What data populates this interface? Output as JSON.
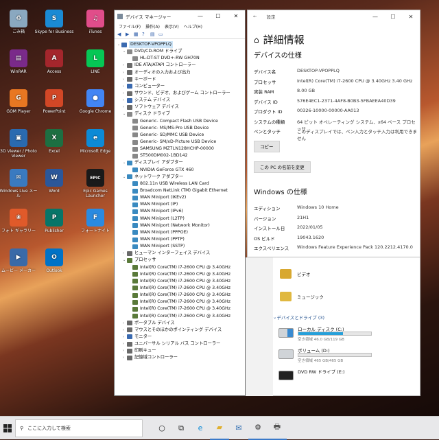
{
  "desktop": {
    "icons": [
      {
        "label": "ごみ箱",
        "icon": "recycle-bin-icon",
        "color": "#8aa8c0",
        "glyph": "♻"
      },
      {
        "label": "Skype for Business",
        "icon": "skype-icon",
        "color": "#1a8ad4",
        "glyph": "S"
      },
      {
        "label": "iTunes",
        "icon": "itunes-icon",
        "color": "#e14d8a",
        "glyph": "♫"
      },
      {
        "label": "WinRAR",
        "icon": "winrar-icon",
        "color": "#7a2a8a",
        "glyph": "▤"
      },
      {
        "label": "Access",
        "icon": "access-icon",
        "color": "#a4262c",
        "glyph": "A"
      },
      {
        "label": "LINE",
        "icon": "line-icon",
        "color": "#06c755",
        "glyph": "L"
      },
      {
        "label": "GOM Player",
        "icon": "gom-player-icon",
        "color": "#e87722",
        "glyph": "G"
      },
      {
        "label": "PowerPoint",
        "icon": "powerpoint-icon",
        "color": "#d24726",
        "glyph": "P"
      },
      {
        "label": "Google Chrome",
        "icon": "chrome-icon",
        "color": "#4285f4",
        "glyph": "●"
      },
      {
        "label": "3D Viewer / Photo Viewer",
        "icon": "photo-viewer-icon",
        "color": "#2a6ab0",
        "glyph": "▣"
      },
      {
        "label": "Excel",
        "icon": "excel-icon",
        "color": "#1d6f42",
        "glyph": "X"
      },
      {
        "label": "Microsoft Edge",
        "icon": "edge-icon",
        "color": "#0c8ad6",
        "glyph": "e"
      },
      {
        "label": "Windows Live メール",
        "icon": "windows-live-mail-icon",
        "color": "#3a7ac0",
        "glyph": "✉"
      },
      {
        "label": "Word",
        "icon": "word-icon",
        "color": "#2b579a",
        "glyph": "W"
      },
      {
        "label": "Epic Games Launcher",
        "icon": "epic-games-icon",
        "color": "#1a1a1a",
        "glyph": "EPIC"
      },
      {
        "label": "フォト ギャラリー",
        "icon": "photo-gallery-icon",
        "color": "#e05a2a",
        "glyph": "❀"
      },
      {
        "label": "Publisher",
        "icon": "publisher-icon",
        "color": "#077568",
        "glyph": "P"
      },
      {
        "label": "フォートナイト",
        "icon": "fortnite-icon",
        "color": "#2a8ae0",
        "glyph": "F"
      },
      {
        "label": "ムービー メーカー",
        "icon": "movie-maker-icon",
        "color": "#3a6aa8",
        "glyph": "▶"
      },
      {
        "label": "Outlook",
        "icon": "outlook-icon",
        "color": "#0072c6",
        "glyph": "O"
      }
    ]
  },
  "devmgr": {
    "title": "デバイス マネージャー",
    "menu": [
      "ファイル(F)",
      "操作(A)",
      "表示(V)",
      "ヘルプ(H)"
    ],
    "tree": [
      {
        "text": "DESKTOP-VPOPPLQ",
        "level": 0,
        "arrow": "v",
        "color": "#3a6ab0"
      },
      {
        "text": "DVD/CD-ROM ドライブ",
        "level": 1,
        "arrow": "v",
        "color": "#888888"
      },
      {
        "text": "HL-DT-ST DVD+-RW GH70N",
        "level": 2,
        "arrow": "",
        "color": "#888888"
      },
      {
        "text": "IDE ATA/ATAPI コントローラー",
        "level": 1,
        "arrow": ">",
        "color": "#6a6a6a"
      },
      {
        "text": "オーディオの入力および出力",
        "level": 1,
        "arrow": ">",
        "color": "#6a6a6a"
      },
      {
        "text": "キーボード",
        "level": 1,
        "arrow": ">",
        "color": "#6a6a6a"
      },
      {
        "text": "コンピューター",
        "level": 1,
        "arrow": ">",
        "color": "#3a6ab0"
      },
      {
        "text": "サウンド、ビデオ、およびゲーム コントローラー",
        "level": 1,
        "arrow": ">",
        "color": "#6a6a6a"
      },
      {
        "text": "システム デバイス",
        "level": 1,
        "arrow": ">",
        "color": "#3a6ab0"
      },
      {
        "text": "ソフトウェア デバイス",
        "level": 1,
        "arrow": ">",
        "color": "#6a6a6a"
      },
      {
        "text": "ディスク ドライブ",
        "level": 1,
        "arrow": "v",
        "color": "#888888"
      },
      {
        "text": "Generic- Compact Flash USB Device",
        "level": 2,
        "arrow": "",
        "color": "#888888"
      },
      {
        "text": "Generic- MS/MS-Pro USB Device",
        "level": 2,
        "arrow": "",
        "color": "#888888"
      },
      {
        "text": "Generic- SD/MMC USB Device",
        "level": 2,
        "arrow": "",
        "color": "#888888"
      },
      {
        "text": "Generic- SM/xD-Picture USB Device",
        "level": 2,
        "arrow": "",
        "color": "#888888"
      },
      {
        "text": "SAMSUNG MZ7LN128HCHP-00000",
        "level": 2,
        "arrow": "",
        "color": "#888888"
      },
      {
        "text": "ST500DM002-1BD142",
        "level": 2,
        "arrow": "",
        "color": "#888888"
      },
      {
        "text": "ディスプレイ アダプター",
        "level": 1,
        "arrow": "v",
        "color": "#3a8ac0"
      },
      {
        "text": "NVIDIA GeForce GTX 460",
        "level": 2,
        "arrow": "",
        "color": "#3a8ac0"
      },
      {
        "text": "ネットワーク アダプター",
        "level": 1,
        "arrow": "v",
        "color": "#3a8ac0"
      },
      {
        "text": "802.11n USB Wireless LAN Card",
        "level": 2,
        "arrow": "",
        "color": "#3a8ac0"
      },
      {
        "text": "Broadcom NetLink (TM) Gigabit Ethernet",
        "level": 2,
        "arrow": "",
        "color": "#3a8ac0"
      },
      {
        "text": "WAN Miniport (IKEv2)",
        "level": 2,
        "arrow": "",
        "color": "#3a8ac0"
      },
      {
        "text": "WAN Miniport (IP)",
        "level": 2,
        "arrow": "",
        "color": "#3a8ac0"
      },
      {
        "text": "WAN Miniport (IPv6)",
        "level": 2,
        "arrow": "",
        "color": "#3a8ac0"
      },
      {
        "text": "WAN Miniport (L2TP)",
        "level": 2,
        "arrow": "",
        "color": "#3a8ac0"
      },
      {
        "text": "WAN Miniport (Network Monitor)",
        "level": 2,
        "arrow": "",
        "color": "#3a8ac0"
      },
      {
        "text": "WAN Miniport (PPPOE)",
        "level": 2,
        "arrow": "",
        "color": "#3a8ac0"
      },
      {
        "text": "WAN Miniport (PPTP)",
        "level": 2,
        "arrow": "",
        "color": "#3a8ac0"
      },
      {
        "text": "WAN Miniport (SSTP)",
        "level": 2,
        "arrow": "",
        "color": "#3a8ac0"
      },
      {
        "text": "ヒューマン インターフェイス デバイス",
        "level": 1,
        "arrow": ">",
        "color": "#6a6a6a"
      },
      {
        "text": "プロセッサ",
        "level": 1,
        "arrow": "v",
        "color": "#5a7a3a"
      },
      {
        "text": "Intel(R) Core(TM) i7-2600 CPU @ 3.40GHz",
        "level": 2,
        "arrow": "",
        "color": "#5a7a3a"
      },
      {
        "text": "Intel(R) Core(TM) i7-2600 CPU @ 3.40GHz",
        "level": 2,
        "arrow": "",
        "color": "#5a7a3a"
      },
      {
        "text": "Intel(R) Core(TM) i7-2600 CPU @ 3.40GHz",
        "level": 2,
        "arrow": "",
        "color": "#5a7a3a"
      },
      {
        "text": "Intel(R) Core(TM) i7-2600 CPU @ 3.40GHz",
        "level": 2,
        "arrow": "",
        "color": "#5a7a3a"
      },
      {
        "text": "Intel(R) Core(TM) i7-2600 CPU @ 3.40GHz",
        "level": 2,
        "arrow": "",
        "color": "#5a7a3a"
      },
      {
        "text": "Intel(R) Core(TM) i7-2600 CPU @ 3.40GHz",
        "level": 2,
        "arrow": "",
        "color": "#5a7a3a"
      },
      {
        "text": "Intel(R) Core(TM) i7-2600 CPU @ 3.40GHz",
        "level": 2,
        "arrow": "",
        "color": "#5a7a3a"
      },
      {
        "text": "Intel(R) Core(TM) i7-2600 CPU @ 3.40GHz",
        "level": 2,
        "arrow": "",
        "color": "#5a7a3a"
      },
      {
        "text": "ポータブル デバイス",
        "level": 1,
        "arrow": ">",
        "color": "#6a6a6a"
      },
      {
        "text": "マウスとそのほかのポインティング デバイス",
        "level": 1,
        "arrow": ">",
        "color": "#6a6a6a"
      },
      {
        "text": "モニター",
        "level": 1,
        "arrow": ">",
        "color": "#3a6ab0"
      },
      {
        "text": "ユニバーサル シリアル バス コントローラー",
        "level": 1,
        "arrow": ">",
        "color": "#6a6a6a"
      },
      {
        "text": "印刷キュー",
        "level": 1,
        "arrow": ">",
        "color": "#6a6a6a"
      },
      {
        "text": "記憶域コントローラー",
        "level": 1,
        "arrow": ">",
        "color": "#6a6a6a"
      }
    ]
  },
  "settings": {
    "title": "設定",
    "page_title": "詳細情報",
    "device_heading": "デバイスの仕様",
    "device_specs": [
      {
        "k": "デバイス名",
        "v": "DESKTOP-VPOPPLQ"
      },
      {
        "k": "プロセッサ",
        "v": "Intel(R) Core(TM) i7-2600 CPU @ 3.40GHz   3.40 GHz"
      },
      {
        "k": "実装 RAM",
        "v": "8.00 GB"
      },
      {
        "k": "デバイス ID",
        "v": "576E4EC1-2371-4AF8-B0B3-5FBAEEA40D39"
      },
      {
        "k": "プロダクト ID",
        "v": "00326-10000-00000-AA013"
      },
      {
        "k": "システムの種類",
        "v": "64 ビット オペレーティング システム、x64 ベース プロセッサ"
      },
      {
        "k": "ペンとタッチ",
        "v": "このディスプレイでは、ペン入力とタッチ入力は利用できません"
      }
    ],
    "copy_button": "コピー",
    "rename_button": "この PC の名前を変更",
    "windows_heading": "Windows の仕様",
    "windows_specs": [
      {
        "k": "エディション",
        "v": "Windows 10 Home"
      },
      {
        "k": "バージョン",
        "v": "21H1"
      },
      {
        "k": "インストール日",
        "v": "2022/01/05"
      },
      {
        "k": "OS ビルド",
        "v": "19043.1620"
      },
      {
        "k": "エクスペリエンス",
        "v": "Windows Feature Experience Pack 120.2212.4170.0"
      }
    ]
  },
  "explorer": {
    "folders": [
      {
        "label": "ビデオ",
        "color": "#d8a830"
      },
      {
        "label": "ミュージック",
        "color": "#e0b840"
      }
    ],
    "drives_heading": "デバイスとドライブ (3)",
    "drives": [
      {
        "name": "ローカル ディスク (C:)",
        "size": "空き領域 46.0 GB/119 GB",
        "used": 0.61
      },
      {
        "name": "ボリューム (D:)",
        "size": "空き領域 465 GB/465 GB",
        "used": 0.0
      },
      {
        "name": "DVD RW ドライブ (E:)",
        "size": "",
        "used": null
      }
    ]
  },
  "taskbar": {
    "search_placeholder": "ここに入力して検索",
    "items": [
      {
        "icon": "cortana-icon",
        "glyph": "○",
        "color": "#222222"
      },
      {
        "icon": "task-view-icon",
        "glyph": "⧉",
        "color": "#222222"
      },
      {
        "icon": "edge-icon",
        "glyph": "e",
        "color": "#0c8ad6"
      },
      {
        "icon": "file-explorer-icon",
        "glyph": "▰",
        "color": "#e0b030"
      },
      {
        "icon": "mail-icon",
        "glyph": "✉",
        "color": "#2a6ab0"
      },
      {
        "icon": "settings-icon",
        "glyph": "⚙",
        "color": "#333333"
      },
      {
        "icon": "device-manager-icon",
        "glyph": "🖶",
        "color": "#555555"
      }
    ]
  }
}
